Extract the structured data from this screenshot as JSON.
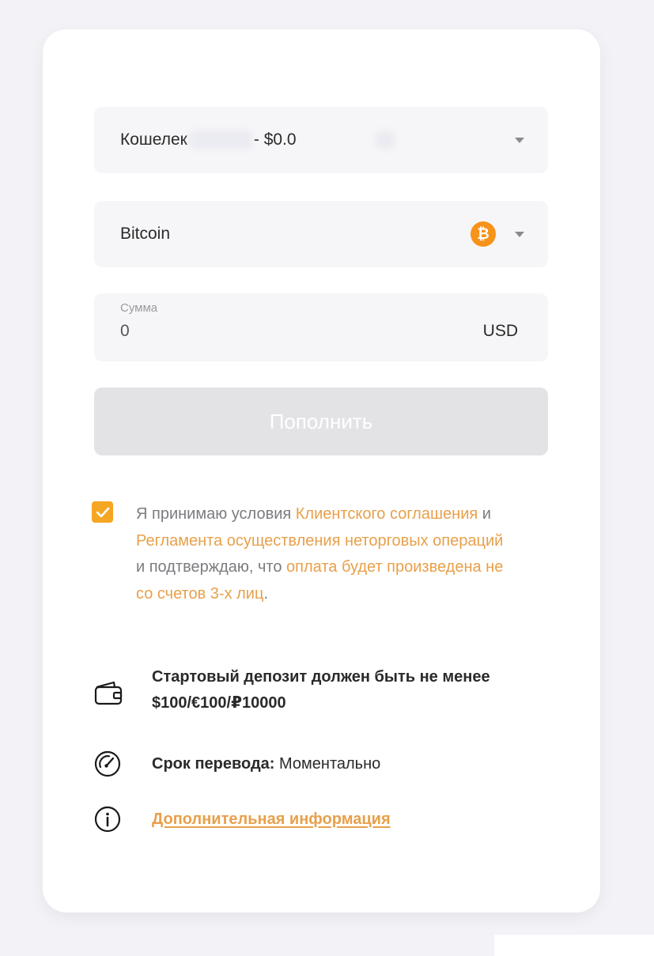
{
  "wallet_select": {
    "prefix": "Кошелек",
    "suffix": "- $0.0"
  },
  "currency_select": {
    "value": "Bitcoin",
    "icon": "bitcoin-icon",
    "icon_glyph": "₿",
    "icon_color": "#f7931a"
  },
  "amount": {
    "label": "Сумма",
    "value": "0",
    "currency": "USD"
  },
  "submit": {
    "label": "Пополнить"
  },
  "terms": {
    "checked": true,
    "text_1": "Я принимаю условия ",
    "link_1": "Клиентского соглашения",
    "text_2": " и ",
    "link_2": "Регламента осуществления неторговых операций",
    "text_3": " и подтверждаю, что ",
    "link_3": "оплата будет произведена не со счетов 3-х лиц",
    "text_4": "."
  },
  "info": {
    "deposit_text": "Стартовый депозит должен быть не менее $100/€100/₽10000",
    "transfer_label": "Срок перевода:",
    "transfer_value": "Моментально",
    "more_link": "Дополнительная информация"
  },
  "colors": {
    "accent": "#f5a623",
    "link": "#e8a04a",
    "disabled_button": "#e3e3e6",
    "page_bg": "#f2f2f7"
  }
}
